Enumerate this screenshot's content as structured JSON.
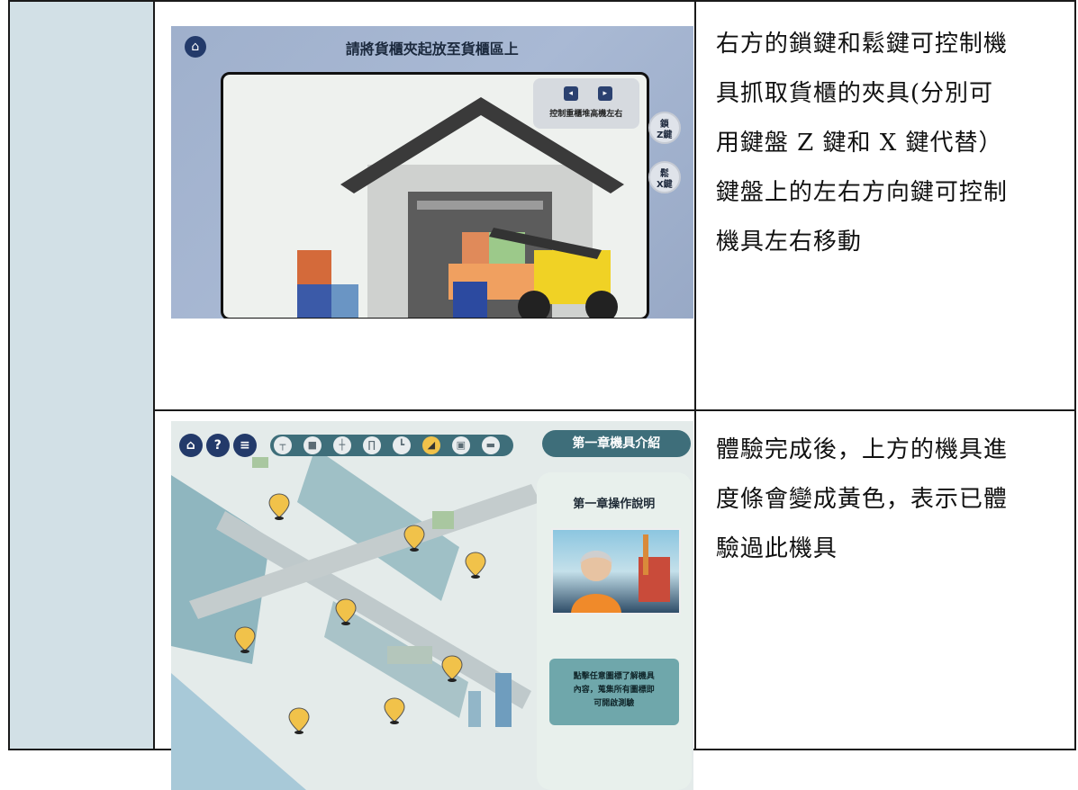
{
  "rows": [
    {
      "description": [
        "右方的鎖鍵和鬆鍵可控制機",
        "具抓取貨櫃的夾具(分別可",
        "用鍵盤 Z 鍵和 X 鍵代替）",
        "鍵盤上的左右方向鍵可控制",
        "機具左右移動"
      ],
      "screenshot": {
        "title": "請將貨櫃夾起放至貨櫃區上",
        "control_label": "控制重櫃堆高機左右",
        "lock_button": {
          "label": "鎖",
          "key": "Z鍵"
        },
        "release_button": {
          "label": "鬆",
          "key": "X鍵"
        },
        "icons": [
          "home-icon",
          "arrow-left-icon",
          "arrow-right-icon"
        ]
      }
    },
    {
      "description": [
        "體驗完成後，上方的機具進",
        "度條會變成黃色，表示已體",
        "驗過此機具"
      ],
      "screenshot": {
        "chapter_button": "第一章機具介紹",
        "panel_title": "第一章操作說明",
        "panel_note": [
          "點擊任意圖標了解機具",
          "內容，蒐集所有圖標即",
          "可開啟測驗"
        ],
        "toolbar_icons": [
          "home-icon",
          "help-icon",
          "clipboard-icon"
        ],
        "progress_icons": [
          {
            "icon": "crane-icon",
            "done": false
          },
          {
            "icon": "forklift-icon",
            "done": false
          },
          {
            "icon": "spreader-icon",
            "done": false
          },
          {
            "icon": "gantry-icon",
            "done": false
          },
          {
            "icon": "truck-crane-icon",
            "done": false
          },
          {
            "icon": "reach-stacker-icon",
            "done": true
          },
          {
            "icon": "loader-icon",
            "done": false
          },
          {
            "icon": "tractor-icon",
            "done": false
          }
        ]
      }
    }
  ],
  "colors": {
    "sidebar": "#d2e0e6",
    "progress_done": "#f1c24a",
    "teal": "#3e6e7a"
  }
}
